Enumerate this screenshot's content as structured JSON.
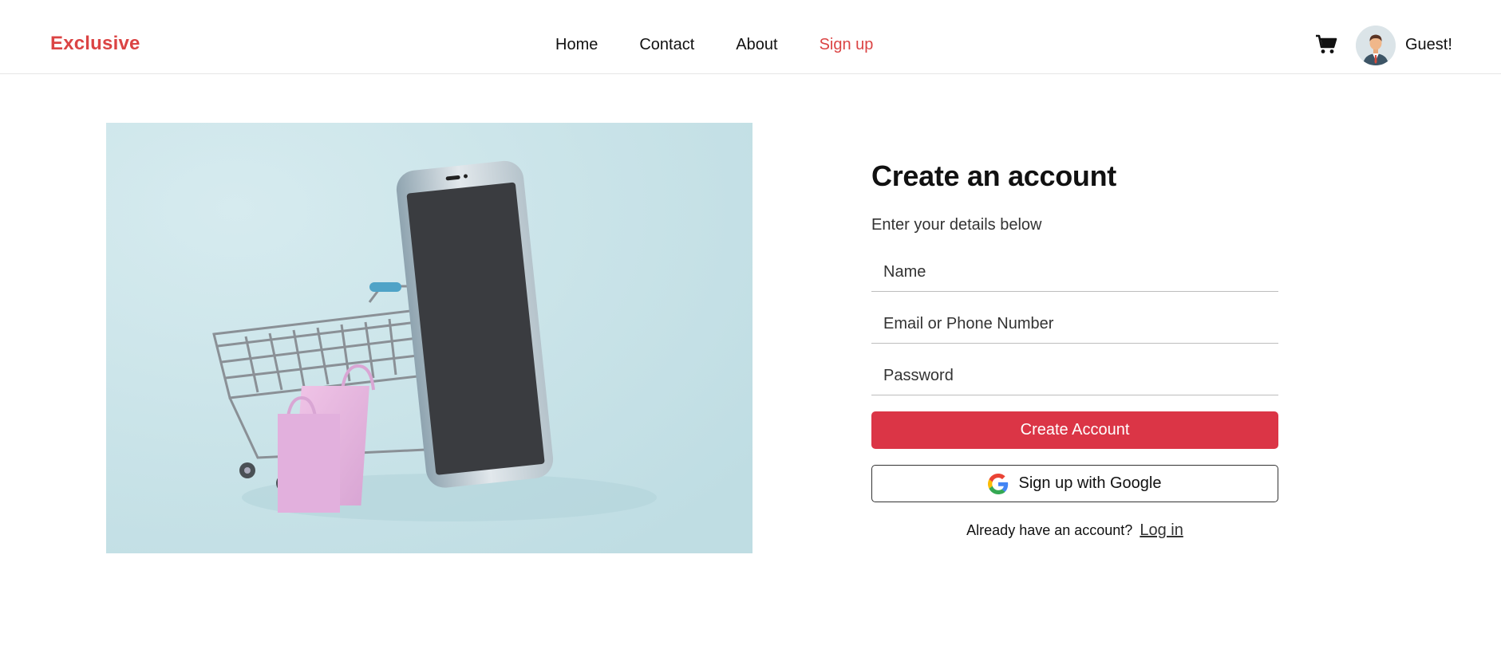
{
  "header": {
    "logo": "Exclusive",
    "nav": [
      {
        "label": "Home"
      },
      {
        "label": "Contact"
      },
      {
        "label": "About"
      },
      {
        "label": "Sign up",
        "active": true
      }
    ],
    "cart_icon": "cart-icon",
    "user_label": "Guest!"
  },
  "hero_image": {
    "description_icon": "shopping-cart-phone-bags-illustration"
  },
  "form": {
    "title": "Create an account",
    "subtitle": "Enter your details below",
    "name_placeholder": "Name",
    "email_placeholder": "Email or Phone Number",
    "password_placeholder": "Password",
    "create_button": "Create Account",
    "google_button": "Sign up with Google",
    "login_prompt": "Already have an account?",
    "login_link": "Log in"
  },
  "colors": {
    "accent": "#db4444",
    "button": "#db3546",
    "hero_bg": "#c9e3e8"
  }
}
